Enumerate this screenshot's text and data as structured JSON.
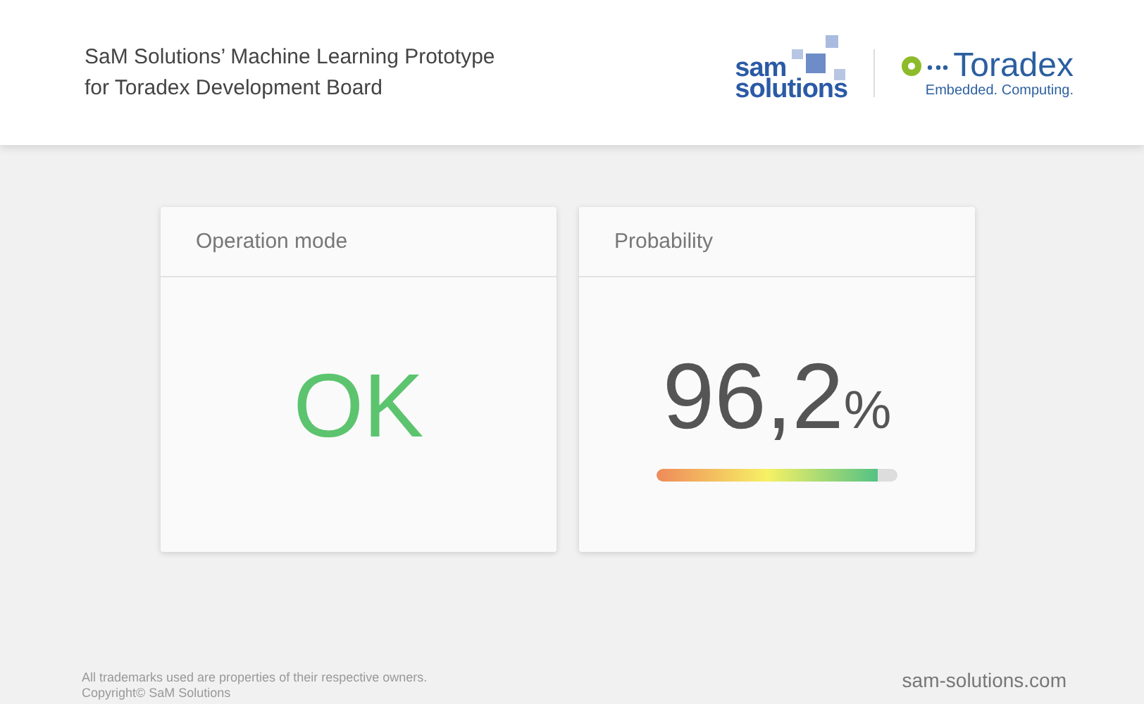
{
  "header": {
    "title_lines": [
      "SaM Solutions’ Machine Learning Prototype",
      "for Toradex Development Board"
    ],
    "logo_left": {
      "line1": "sam",
      "line2": "solutions"
    },
    "logo_right": {
      "name": "Toradex",
      "tagline": "Embedded. Computing."
    }
  },
  "cards": [
    {
      "kind": "status",
      "title": "Operation mode",
      "value": "OK",
      "color": "#5cc46e"
    },
    {
      "kind": "gauge",
      "title": "Probability",
      "value": "96,2",
      "unit": "%",
      "level": 0.92
    }
  ],
  "footer": {
    "notes": [
      "All trademarks used are properties of their respective owners.",
      "Copyright©  SaM Solutions"
    ],
    "site": "sam-solutions.com"
  }
}
